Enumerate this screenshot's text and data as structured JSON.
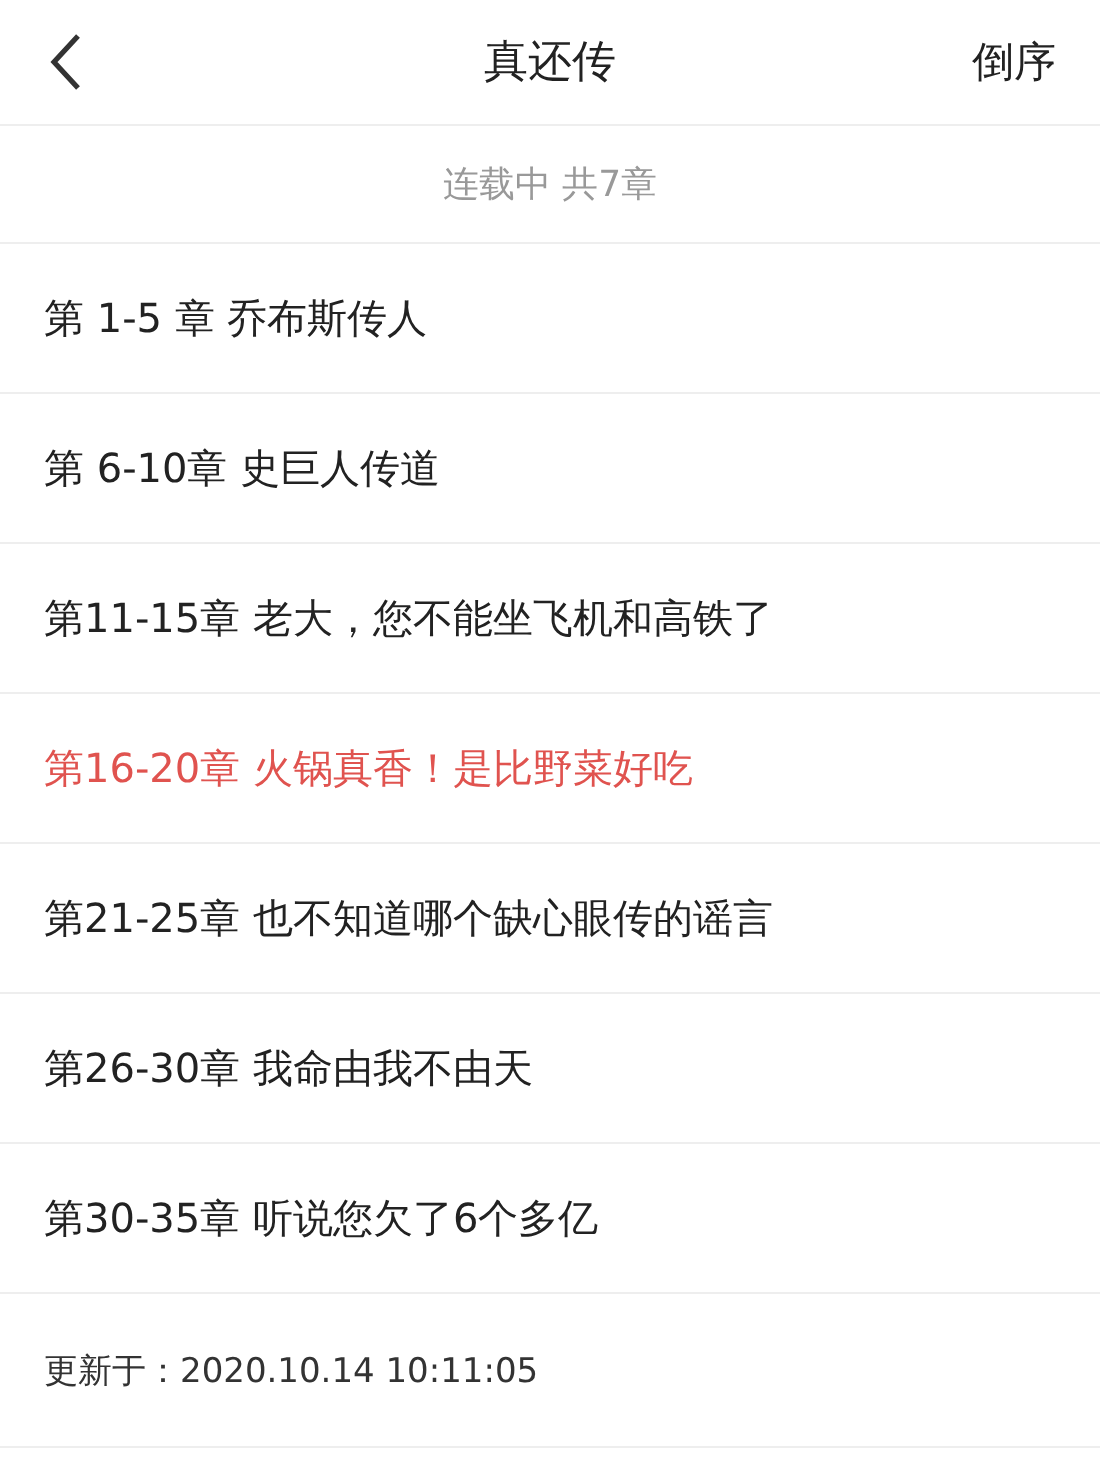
{
  "header": {
    "title": "真还传",
    "sort_button": "倒序"
  },
  "summary": "连载中 共7章",
  "chapters": [
    {
      "label": "第 1-5 章 乔布斯传人",
      "selected": false
    },
    {
      "label": "第 6-10章 史巨人传道",
      "selected": false
    },
    {
      "label": "第11-15章 老大，您不能坐飞机和高铁了",
      "selected": false
    },
    {
      "label": "第16-20章 火锅真香！是比野菜好吃",
      "selected": true
    },
    {
      "label": "第21-25章 也不知道哪个缺心眼传的谣言",
      "selected": false
    },
    {
      "label": "第26-30章 我命由我不由天",
      "selected": false
    },
    {
      "label": "第30-35章 听说您欠了6个多亿",
      "selected": false
    }
  ],
  "updated": "更新于：2020.10.14 10:11:05"
}
